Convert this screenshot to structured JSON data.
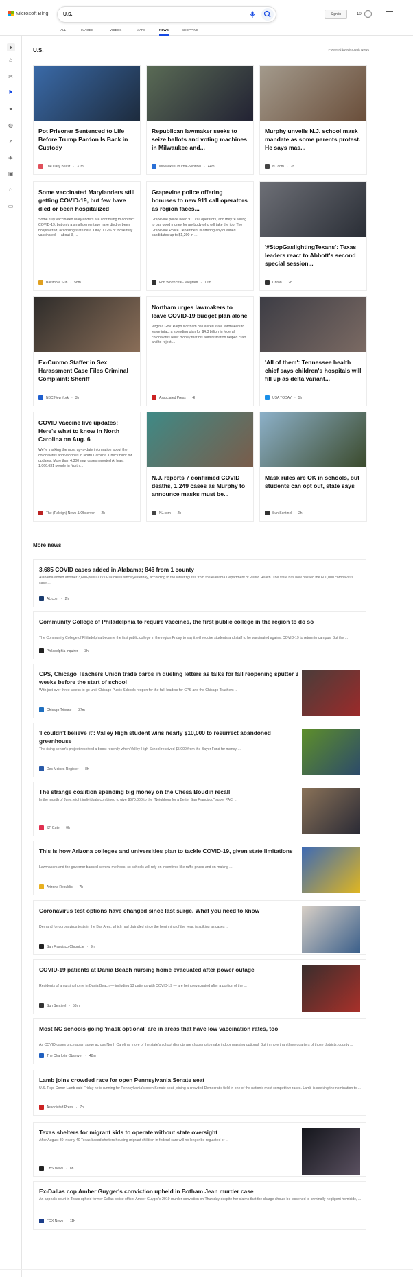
{
  "header": {
    "brand": "Microsoft Bing",
    "brand_colors": [
      "#f25022",
      "#7fba00",
      "#00a4ef",
      "#ffb900"
    ],
    "search_value": "U.S.",
    "signin_label": "Sign in",
    "rewards_count": "10",
    "tabs": [
      {
        "label": "ALL"
      },
      {
        "label": "IMAGES"
      },
      {
        "label": "VIDEOS"
      },
      {
        "label": "MAPS"
      },
      {
        "label": "NEWS",
        "active": true
      },
      {
        "label": "SHOPPING"
      }
    ],
    "accent": "#174ae4"
  },
  "sidebar": {
    "icons": [
      "expand-icon",
      "home-icon",
      "sports-icon",
      "flag-icon",
      "location-pin-icon",
      "globe-icon",
      "stocks-icon",
      "science-icon",
      "entertainment-icon",
      "government-icon",
      "money-icon"
    ]
  },
  "section": {
    "title": "U.S.",
    "powered": "Powered by Microsoft News"
  },
  "cards": [
    {
      "title": "Pot Prisoner Sentenced to Life Before Trump Pardon Is Back in Custody",
      "snippet": "",
      "source": "The Daily Beast",
      "time": "31m",
      "img": "#3a6aa8",
      "img2": "#1d2b3d",
      "icon": "#e0505b"
    },
    {
      "title": "Republican lawmaker seeks to seize ballots and voting machines in Milwaukee and...",
      "snippet": "",
      "source": "Milwaukee Journal-Sentinel",
      "time": "44m",
      "img": "#5a6b55",
      "img2": "#223",
      "icon": "#2a6fd6"
    },
    {
      "title": "Murphy unveils N.J. school mask mandate as some parents protest. He says mas...",
      "snippet": "",
      "source": "NJ.com",
      "time": "2h",
      "img": "#a39a8c",
      "img2": "#6a4e3a",
      "icon": "#444"
    },
    {
      "title": "Some vaccinated Marylanders still getting COVID-19, but few have died or been hospitalized",
      "snippet": "Some fully vaccinated Marylanders are continuing to contract COVID-19, but only a small percentage have died or been hospitalized, according state data. Only 0.12% of those fully vaccinated — about 3, ...",
      "source": "Baltimore Sun",
      "time": "58m",
      "icon": "#e0a020"
    },
    {
      "title": "Grapevine police offering bonuses to new 911 call operators as region faces...",
      "snippet": "Grapevine police need 911 call operators, and they're willing to pay good money for anybody who will take the job. The Grapevine Police Department is offering any qualified candidates up to $1,200 in ...",
      "source": "Fort Worth Star-Telegram",
      "time": "12m",
      "icon": "#333"
    },
    {
      "title": "'#StopGaslightingTexans': Texas leaders react to Abbott's second special session...",
      "snippet": "",
      "source": "Chron",
      "time": "2h",
      "img": "#6d6f76",
      "img2": "#2a2e36",
      "icon": "#333"
    },
    {
      "title": "Ex-Cuomo Staffer in Sex Harassment Case Files Criminal Complaint: Sheriff",
      "snippet": "",
      "source": "NBC New York",
      "time": "3h",
      "img": "#2e2c2a",
      "img2": "#8a6e58",
      "icon": "#1f5fcf"
    },
    {
      "title": "Northam urges lawmakers to leave COVID-19 budget plan alone",
      "snippet": "Virginia Gov. Ralph Northam has asked state lawmakers to leave intact a spending plan for $4.3 billion in federal coronavirus relief money that his administration helped craft and to reject ...",
      "source": "Associated Press",
      "time": "4h",
      "icon": "#c22"
    },
    {
      "title": "'All of them': Tennessee health chief says children's hospitals will fill up as delta variant...",
      "snippet": "",
      "source": "USA TODAY",
      "time": "5h",
      "img": "#3d3d45",
      "img2": "#7b6a63",
      "icon": "#1b8fe8"
    },
    {
      "title": "COVID vaccine live updates: Here's what to know in North Carolina on Aug. 6",
      "snippet": "We're tracking the most up-to-date information about the coronavirus and vaccines in North Carolina. Check back for updates. More than 4,300 new cases reported At least 1,066,631 people in North ...",
      "source": "The (Raleigh) News & Observer",
      "time": "2h",
      "icon": "#b22"
    },
    {
      "title": "N.J. reports 7 confirmed COVID deaths, 1,249 cases as Murphy to announce masks must be...",
      "snippet": "",
      "source": "NJ.com",
      "time": "2h",
      "img": "#3f8a86",
      "img2": "#7a5c4a",
      "icon": "#444"
    },
    {
      "title": "Mask rules are OK in schools, but students can opt out, state says",
      "snippet": "",
      "source": "Sun Sentinel",
      "time": "2h",
      "img": "#8cb0c8",
      "img2": "#3b4a2c",
      "icon": "#333"
    }
  ],
  "more_news_title": "More news",
  "more_news": [
    {
      "title": "3,685 COVID cases added in Alabama; 846 from 1 county",
      "snippet": "Alabama added another 3,600-plus COVID-19 cases since yesterday, according to the latest figures from the Alabama Department of Public Health. The state has now passed the 600,000 coronavirus case ...",
      "source": "AL.com",
      "time": "2h",
      "icon": "#1a3b6e"
    },
    {
      "title": "Community College of Philadelphia to require vaccines, the first public college in the region to do so",
      "snippet": "The Community College of Philadelphia became the first public college in the region Friday to say it will require students and staff to be vaccinated against COVID-19 to return to campus. But the ...",
      "source": "Philadelphia Inquirer",
      "time": "3h",
      "icon": "#222"
    },
    {
      "title": "CPS, Chicago Teachers Union trade barbs in dueling letters as talks for fall reopening sputter 3 weeks before the start of school",
      "snippet": "With just over three weeks to go until Chicago Public Schools reopen for the fall, leaders for CPS and the Chicago Teachers ...",
      "source": "Chicago Tribune",
      "time": "37m",
      "icon": "#1f6fbf",
      "img": "#4a3d3a",
      "img2": "#9c2a2a"
    },
    {
      "title": "'I couldn't believe it': Valley High student wins nearly $10,000 to resurrect abandoned greenhouse",
      "snippet": "The rising senior's project received a boost recently when Valley High School received $5,000 from the Bayer Fund for money ...",
      "source": "Des Moines Register",
      "time": "8h",
      "icon": "#2a5aa8",
      "img": "#5e8f2a",
      "img2": "#2c4a6a"
    },
    {
      "title": "The strange coalition spending big money on the Chesa Boudin recall",
      "snippet": "In the month of June, eight individuals combined to give $670,000 to the \"Neighbors for a Better San Francisco\" super PAC, ...",
      "source": "SF Gate",
      "time": "9h",
      "icon": "#e03050",
      "img": "#8a7258",
      "img2": "#2a2a35"
    },
    {
      "title": "This is how Arizona colleges and universities plan to tackle COVID-19, given state limitations",
      "snippet": "Lawmakers and the governor banned several methods, so schools will rely on incentives like raffle prizes and on making ...",
      "source": "Arizona Republic",
      "time": "7h",
      "icon": "#e8b020",
      "img": "#3d6ab5",
      "img2": "#e0b620"
    },
    {
      "title": "Coronavirus test options have changed since last surge. What you need to know",
      "snippet": "Demand for coronavirus tests in the Bay Area, which had dwindled since the beginning of the year, is spiking as cases ...",
      "source": "San Francisco Chronicle",
      "time": "9h",
      "icon": "#222",
      "img": "#d7cfc6",
      "img2": "#3b5f8a"
    },
    {
      "title": "COVID-19 patients at Dania Beach nursing home evacuated after power outage",
      "snippet": "Residents of a nursing home in Dania Beach — including 13 patients with COVID-19 — are being evacuated after a portion of the ...",
      "source": "Sun Sentinel",
      "time": "53m",
      "icon": "#333",
      "img": "#3a2e2c",
      "img2": "#a8302a"
    },
    {
      "title": "Most NC schools going 'mask optional' are in areas that have low vaccination rates, too",
      "snippet": "As COVID cases once again surge across North Carolina, more of the state's school districts are choosing to make indoor masking optional. But in more than three quarters of those districts, county ...",
      "source": "The Charlotte Observer",
      "time": "48m",
      "icon": "#2060c0"
    },
    {
      "title": "Lamb joins crowded race for open Pennsylvania Senate seat",
      "snippet": "U.S. Rep. Conor Lamb said Friday he is running for Pennsylvania's open Senate seat, joining a crowded Democratic field in one of the nation's most competitive races. Lamb is seeking the nomination to ...",
      "source": "Associated Press",
      "time": "7h",
      "icon": "#c22"
    },
    {
      "title": "Texas shelters for migrant kids to operate without state oversight",
      "snippet": "After August 30, nearly 40 Texas-based shelters housing migrant children in federal care will no longer be regulated or ...",
      "source": "CBS News",
      "time": "8h",
      "icon": "#222",
      "img": "#14161c",
      "img2": "#5a5060"
    },
    {
      "title": "Ex-Dallas cop Amber Guyger's conviction upheld in Botham Jean murder case",
      "snippet": "An appeals court in Texas upheld former Dallas police officer Amber Guyger's 2019 murder conviction on Thursday despite her claims that the charge should be lessened to criminally negligent homicide, ...",
      "source": "FOX News",
      "time": "11h",
      "icon": "#1b3d8a"
    }
  ]
}
